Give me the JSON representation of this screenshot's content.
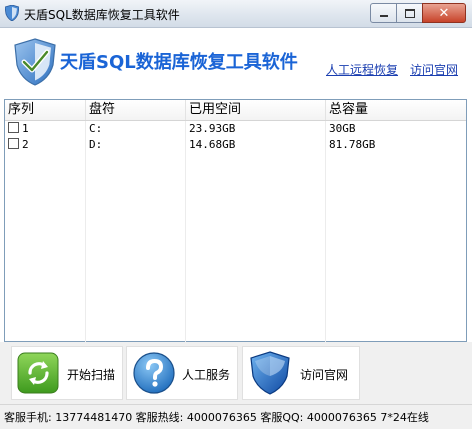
{
  "window": {
    "title": "天盾SQL数据库恢复工具软件",
    "controls": {
      "minimize": "minimize",
      "maximize": "maximize",
      "close": "✕"
    }
  },
  "header": {
    "app_title": "天盾SQL数据库恢复工具软件",
    "links": {
      "remote_recovery": "人工远程恢复",
      "official_site": "访问官网"
    }
  },
  "table": {
    "columns": [
      "序列",
      "盘符",
      "已用空间",
      "总容量"
    ],
    "rows": [
      {
        "index": "1",
        "drive": "C:",
        "used": "23.93GB",
        "total": "30GB",
        "checked": false
      },
      {
        "index": "2",
        "drive": "D:",
        "used": "14.68GB",
        "total": "81.78GB",
        "checked": false
      }
    ]
  },
  "toolbar": {
    "scan_label": "开始扫描",
    "service_label": "人工服务",
    "visit_label": "访问官网"
  },
  "status": {
    "text": "客服手机: 13774481470 客服热线: 4000076365 客服QQ: 4000076365 7*24在线"
  },
  "icons": {
    "title": "shield-icon",
    "logo": "shield-logo-icon",
    "scan": "refresh-icon",
    "service": "help-icon",
    "visit": "shield-icon"
  },
  "colors": {
    "title_blue": "#1a64d6",
    "link_blue": "#1a3eb0",
    "close_red": "#c7432a"
  }
}
